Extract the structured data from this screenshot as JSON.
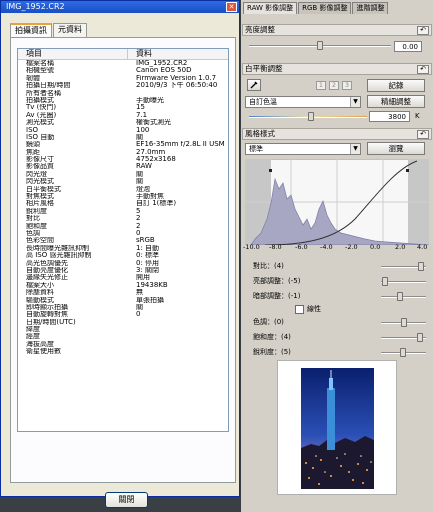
{
  "info_window": {
    "title": "IMG_1952.CR2",
    "tabs": [
      "拍攝資訊",
      "元資料"
    ],
    "columns": {
      "item": "項目",
      "data": "資料"
    },
    "rows": [
      [
        "檔案名稱",
        "IMG_1952.CR2"
      ],
      [
        "相機型號",
        "Canon EOS 50D"
      ],
      [
        "韌體",
        "Firmware Version 1.0.7"
      ],
      [
        "拍攝日期/時間",
        "2010/9/3 下午 06:50:40"
      ],
      [
        "所有者名稱",
        ""
      ],
      [
        "拍攝模式",
        "手動曝光"
      ],
      [
        "Tv (快門)",
        "15"
      ],
      [
        "Av (光圈)",
        "7.1"
      ],
      [
        "測光模式",
        "權衡式測光"
      ],
      [
        "ISO",
        "100"
      ],
      [
        "ISO 自動",
        "關"
      ],
      [
        "鏡頭",
        "EF16-35mm f/2.8L II USM"
      ],
      [
        "焦距",
        "27.0mm"
      ],
      [
        "影像尺寸",
        "4752x3168"
      ],
      [
        "影像品質",
        "RAW"
      ],
      [
        "閃光燈",
        "關"
      ],
      [
        "閃光模式",
        "關"
      ],
      [
        "白平衡模式",
        "燈泡"
      ],
      [
        "對焦模式",
        "手動對焦"
      ],
      [
        "相片風格",
        "自訂 1(標準)"
      ],
      [
        "銳利度",
        "5"
      ],
      [
        "對比",
        "2"
      ],
      [
        "飽和度",
        "2"
      ],
      [
        "色調",
        "0"
      ],
      [
        "色彩空間",
        "sRGB"
      ],
      [
        "長時間曝光雜訊抑制",
        "1: 自動"
      ],
      [
        "高 ISO 感光雜訊抑制",
        "0: 標準"
      ],
      [
        "高光色調優先",
        "0: 停用"
      ],
      [
        "自動亮度優化",
        "3: 關閉"
      ],
      [
        "邊緣失光修正",
        "開用"
      ],
      [
        "檔案大小",
        "19438KB"
      ],
      [
        "除塵資料",
        "無"
      ],
      [
        "驅動模式",
        "單張拍攝"
      ],
      [
        "即時顯示拍攝",
        "關"
      ],
      [
        "自動旋轉對焦",
        "0"
      ],
      [
        "日期/時間(UTC)",
        ""
      ],
      [
        "緯度",
        ""
      ],
      [
        "經度",
        ""
      ],
      [
        "海拔高度",
        ""
      ],
      [
        "衛星使用數",
        ""
      ]
    ],
    "close_button": "關閉"
  },
  "tool_palette": {
    "tabs": [
      "RAW 影像調整",
      "RGB 影像調整",
      "進階調整"
    ],
    "brightness": {
      "label": "亮度調整",
      "value": "0.00",
      "level": 0.5
    },
    "white_balance": {
      "label": "白平衡調整",
      "presets": [
        "1",
        "2",
        "3"
      ],
      "record_button": "記錄",
      "mode": "自訂色溫",
      "fine_tune_button": "精細調整",
      "temperature": "3800",
      "unit": "K"
    },
    "picture_style": {
      "label": "風格樣式",
      "style": "標準",
      "browse_button": "瀏覽",
      "axis_ticks": [
        "-10.0",
        "-8.0",
        "-6.0",
        "-4.0",
        "-2.0",
        "0.0",
        "2.0",
        "4.0"
      ],
      "contrast_label": "對比：(4)",
      "highlight_label": "亮部調整：(-5)",
      "shadow_label": "暗部調整：(-1)",
      "linear_label": "線性",
      "tone_label": "色調：(0)",
      "saturation_label": "飽和度：(4)",
      "sharpness_label": "銳利度：(5)"
    }
  }
}
